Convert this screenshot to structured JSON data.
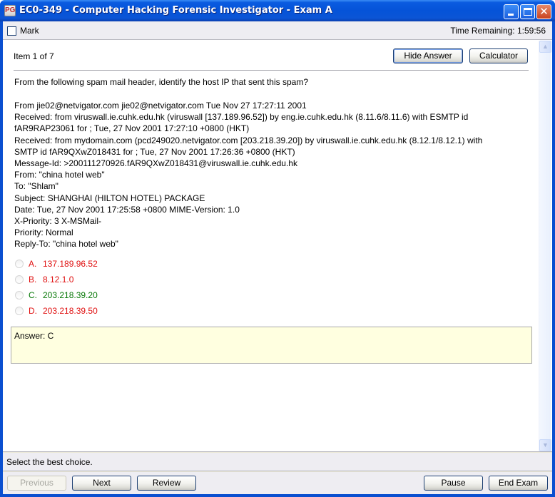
{
  "window": {
    "title": "EC0-349 - Computer Hacking Forensic Investigator - Exam A",
    "app_icon": "PG",
    "controls": {
      "minimize": "minimize-icon",
      "maximize": "maximize-icon",
      "close": "✕"
    }
  },
  "topbar": {
    "mark_label": "Mark",
    "mark_checked": false,
    "time_remaining": "Time Remaining: 1:59:56"
  },
  "content": {
    "item_label": "Item 1 of 7",
    "hide_answer_label": "Hide Answer",
    "calculator_label": "Calculator",
    "question": "From the following spam mail header, identify the host IP that sent this spam?",
    "header_lines": [
      "From jie02@netvigator.com jie02@netvigator.com Tue Nov 27 17:27:11 2001",
      "Received: from viruswall.ie.cuhk.edu.hk (viruswall [137.189.96.52]) by eng.ie.cuhk.edu.hk (8.11.6/8.11.6) with ESMTP id",
      "fAR9RAP23061 for ; Tue, 27 Nov 2001 17:27:10 +0800 (HKT)",
      "Received: from mydomain.com (pcd249020.netvigator.com [203.218.39.20]) by viruswall.ie.cuhk.edu.hk (8.12.1/8.12.1) with",
      "SMTP id fAR9QXwZ018431 for ; Tue, 27 Nov 2001 17:26:36 +0800 (HKT)",
      "Message-Id: >200111270926.fAR9QXwZ018431@viruswall.ie.cuhk.edu.hk",
      "From: \"china hotel web\"",
      "To: \"Shlam\"",
      "Subject: SHANGHAI (HILTON HOTEL) PACKAGE",
      "Date: Tue, 27 Nov 2001 17:25:58 +0800 MIME-Version: 1.0",
      "X-Priority: 3 X-MSMail-",
      "Priority: Normal",
      "Reply-To: \"china hotel web\""
    ],
    "choices": [
      {
        "letter": "A.",
        "text": "137.189.96.52",
        "correct": false
      },
      {
        "letter": "B.",
        "text": "8.12.1.0",
        "correct": false
      },
      {
        "letter": "C.",
        "text": "203.218.39.20",
        "correct": true
      },
      {
        "letter": "D.",
        "text": "203.218.39.50",
        "correct": false
      }
    ],
    "answer_text": "Answer: C"
  },
  "colors": {
    "correct": "#0a7a0a",
    "incorrect": "#e01010",
    "answer_bg": "#ffffe0"
  },
  "status": {
    "text": "Select the best choice."
  },
  "bottombar": {
    "previous_label": "Previous",
    "next_label": "Next",
    "review_label": "Review",
    "pause_label": "Pause",
    "end_exam_label": "End Exam"
  }
}
